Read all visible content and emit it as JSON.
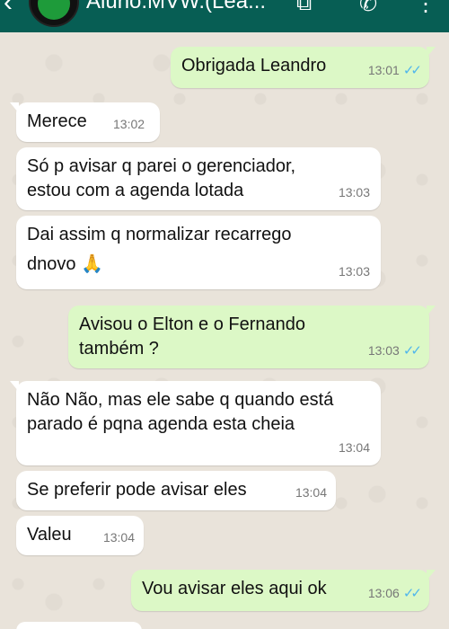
{
  "header": {
    "title": "Aluno.MVW.(Lea...",
    "back_icon": "arrow-left",
    "video_icon": "video-camera",
    "phone_icon": "phone",
    "menu_icon": "more-vertical"
  },
  "colors": {
    "header": "#075e54",
    "incoming_bubble": "#ffffff",
    "outgoing_bubble": "#dcf8c6",
    "read_ticks": "#4fb6ec",
    "wallpaper": "#ece5dd"
  },
  "messages": [
    {
      "dir": "out",
      "text": "Obrigada Leandro",
      "time": "13:01",
      "status": "read"
    },
    {
      "dir": "in",
      "text": "Merece",
      "time": "13:02"
    },
    {
      "dir": "in",
      "text_line1": "Só p avisar q parei o gerenciador,",
      "text_line2": "estou com a agenda lotada",
      "time": "13:03"
    },
    {
      "dir": "in",
      "text_line1": "Dai assim q normalizar recarrego",
      "text_line2": "dnovo",
      "emoji": "🙏",
      "time": "13:03"
    },
    {
      "dir": "out",
      "text_line1": "Avisou o Elton e o Fernando",
      "text_line2": "também ?",
      "time": "13:03",
      "status": "read"
    },
    {
      "dir": "in",
      "text_line1": "Não Não, mas ele sabe q quando está",
      "text_line2": "parado é pqna agenda esta cheia",
      "time": "13:04"
    },
    {
      "dir": "in",
      "text": "Se preferir pode avisar eles",
      "time": "13:04"
    },
    {
      "dir": "in",
      "text": "Valeu",
      "time": "13:04"
    },
    {
      "dir": "out",
      "text": "Vou avisar eles aqui ok",
      "time": "13:06",
      "status": "read"
    }
  ]
}
